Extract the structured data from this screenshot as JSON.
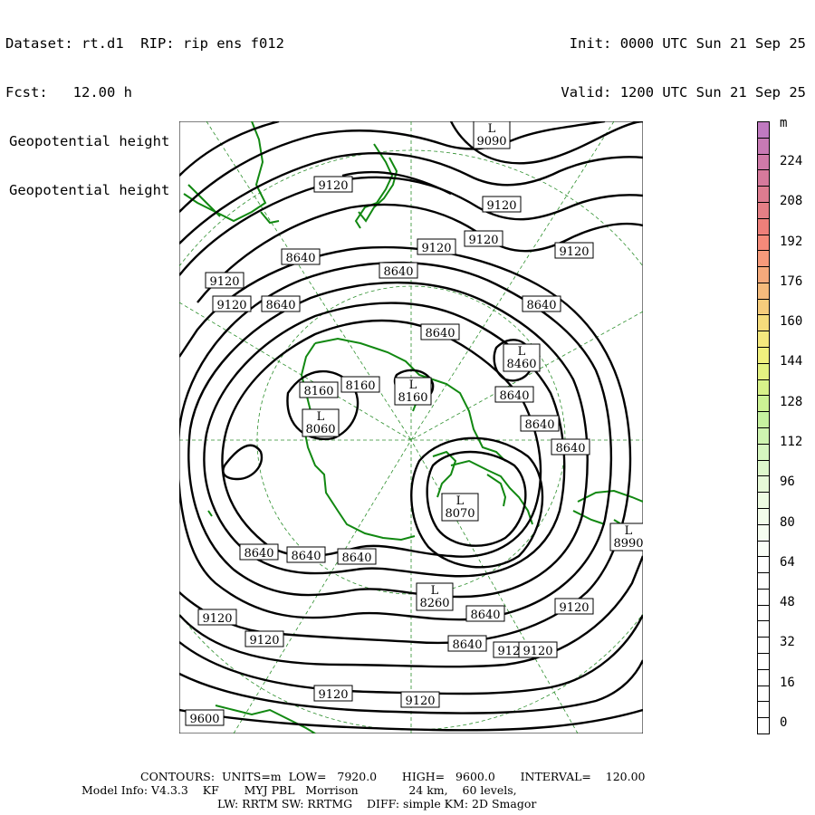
{
  "header": {
    "dataset": "Dataset: rt.d1  RIP: rip ens f012",
    "fcst": "Fcst:   12.00 h",
    "field1": "Geopotential height",
    "field2": "Geopotential height",
    "init": "Init: 0000 UTC Sun 21 Sep 25",
    "valid": "Valid: 1200 UTC Sun 21 Sep 25"
  },
  "colorbar": {
    "unit": "m",
    "labels": [
      "224",
      "208",
      "192",
      "176",
      "160",
      "144",
      "128",
      "112",
      "96",
      "80",
      "64",
      "48",
      "32",
      "16",
      "0"
    ],
    "colors": [
      "#c07ac0",
      "#c77ab4",
      "#cf7aa8",
      "#d67a9c",
      "#de7c90",
      "#e57f86",
      "#ee7f7a",
      "#f58a7a",
      "#f69a7b",
      "#f5aa7c",
      "#f5bb7c",
      "#f6cc7c",
      "#f5dc7c",
      "#f5e97e",
      "#f0f07e",
      "#e4f282",
      "#d8f28a",
      "#ccf294",
      "#c6f2a0",
      "#cef4b0",
      "#d6f6c0",
      "#def8cc",
      "#e6f9d8",
      "#edfbe2",
      "#f2fcea",
      "#f6fdf1",
      "#fafef7",
      "#ffffff",
      "#ffffff",
      "#ffffff",
      "#ffffff",
      "#ffffff",
      "#ffffff",
      "#ffffff",
      "#ffffff",
      "#ffffff",
      "#ffffff",
      "#ffffff"
    ]
  },
  "contour_labels": [
    {
      "text": "9120"
    },
    {
      "text": "9120"
    },
    {
      "text": "9120"
    },
    {
      "text": "9120"
    },
    {
      "text": "9120"
    },
    {
      "text": "9120"
    },
    {
      "text": "9120"
    },
    {
      "text": "9120"
    },
    {
      "text": "9120"
    },
    {
      "text": "9120"
    },
    {
      "text": "9120"
    },
    {
      "text": "9120"
    },
    {
      "text": "9120"
    },
    {
      "text": "9120"
    },
    {
      "text": "8640"
    },
    {
      "text": "8640"
    },
    {
      "text": "8640"
    },
    {
      "text": "8640"
    },
    {
      "text": "8640"
    },
    {
      "text": "8640"
    },
    {
      "text": "8640"
    },
    {
      "text": "8640"
    },
    {
      "text": "8640"
    },
    {
      "text": "8640"
    },
    {
      "text": "8640"
    },
    {
      "text": "8640"
    },
    {
      "text": "8640"
    },
    {
      "text": "8160"
    },
    {
      "text": "8160"
    },
    {
      "text": "9600"
    }
  ],
  "lows": [
    {
      "label": "L",
      "value": "9090"
    },
    {
      "label": "L",
      "value": "8460"
    },
    {
      "label": "L",
      "value": "8160"
    },
    {
      "label": "L",
      "value": "8060"
    },
    {
      "label": "L",
      "value": "8070"
    },
    {
      "label": "L",
      "value": "8260"
    },
    {
      "label": "L",
      "value": "8990"
    }
  ],
  "footer": {
    "line1": "CONTOURS:  UNITS=m  LOW=   7920.0       HIGH=   9600.0       INTERVAL=    120.00",
    "line2": "Model Info: V4.3.3    KF       MYJ PBL   Morrison              24 km,    60 levels,",
    "line3": "LW: RRTM SW: RRTMG    DIFF: simple KM: 2D Smagor"
  }
}
